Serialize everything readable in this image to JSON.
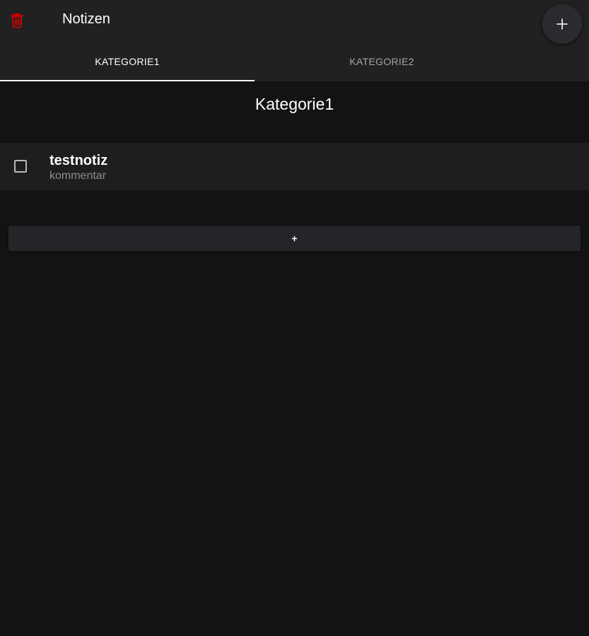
{
  "header": {
    "title": "Notizen",
    "delete_icon": "trash-icon",
    "add_icon": "plus-icon",
    "accent_delete": "#d50000"
  },
  "tabs": [
    {
      "label": "KATEGORIE1",
      "active": true
    },
    {
      "label": "KATEGORIE2",
      "active": false
    }
  ],
  "main": {
    "section_title": "Kategorie1",
    "notes": [
      {
        "title": "testnotiz",
        "comment": "kommentar",
        "checked": false
      }
    ],
    "add_button_label": "+"
  }
}
